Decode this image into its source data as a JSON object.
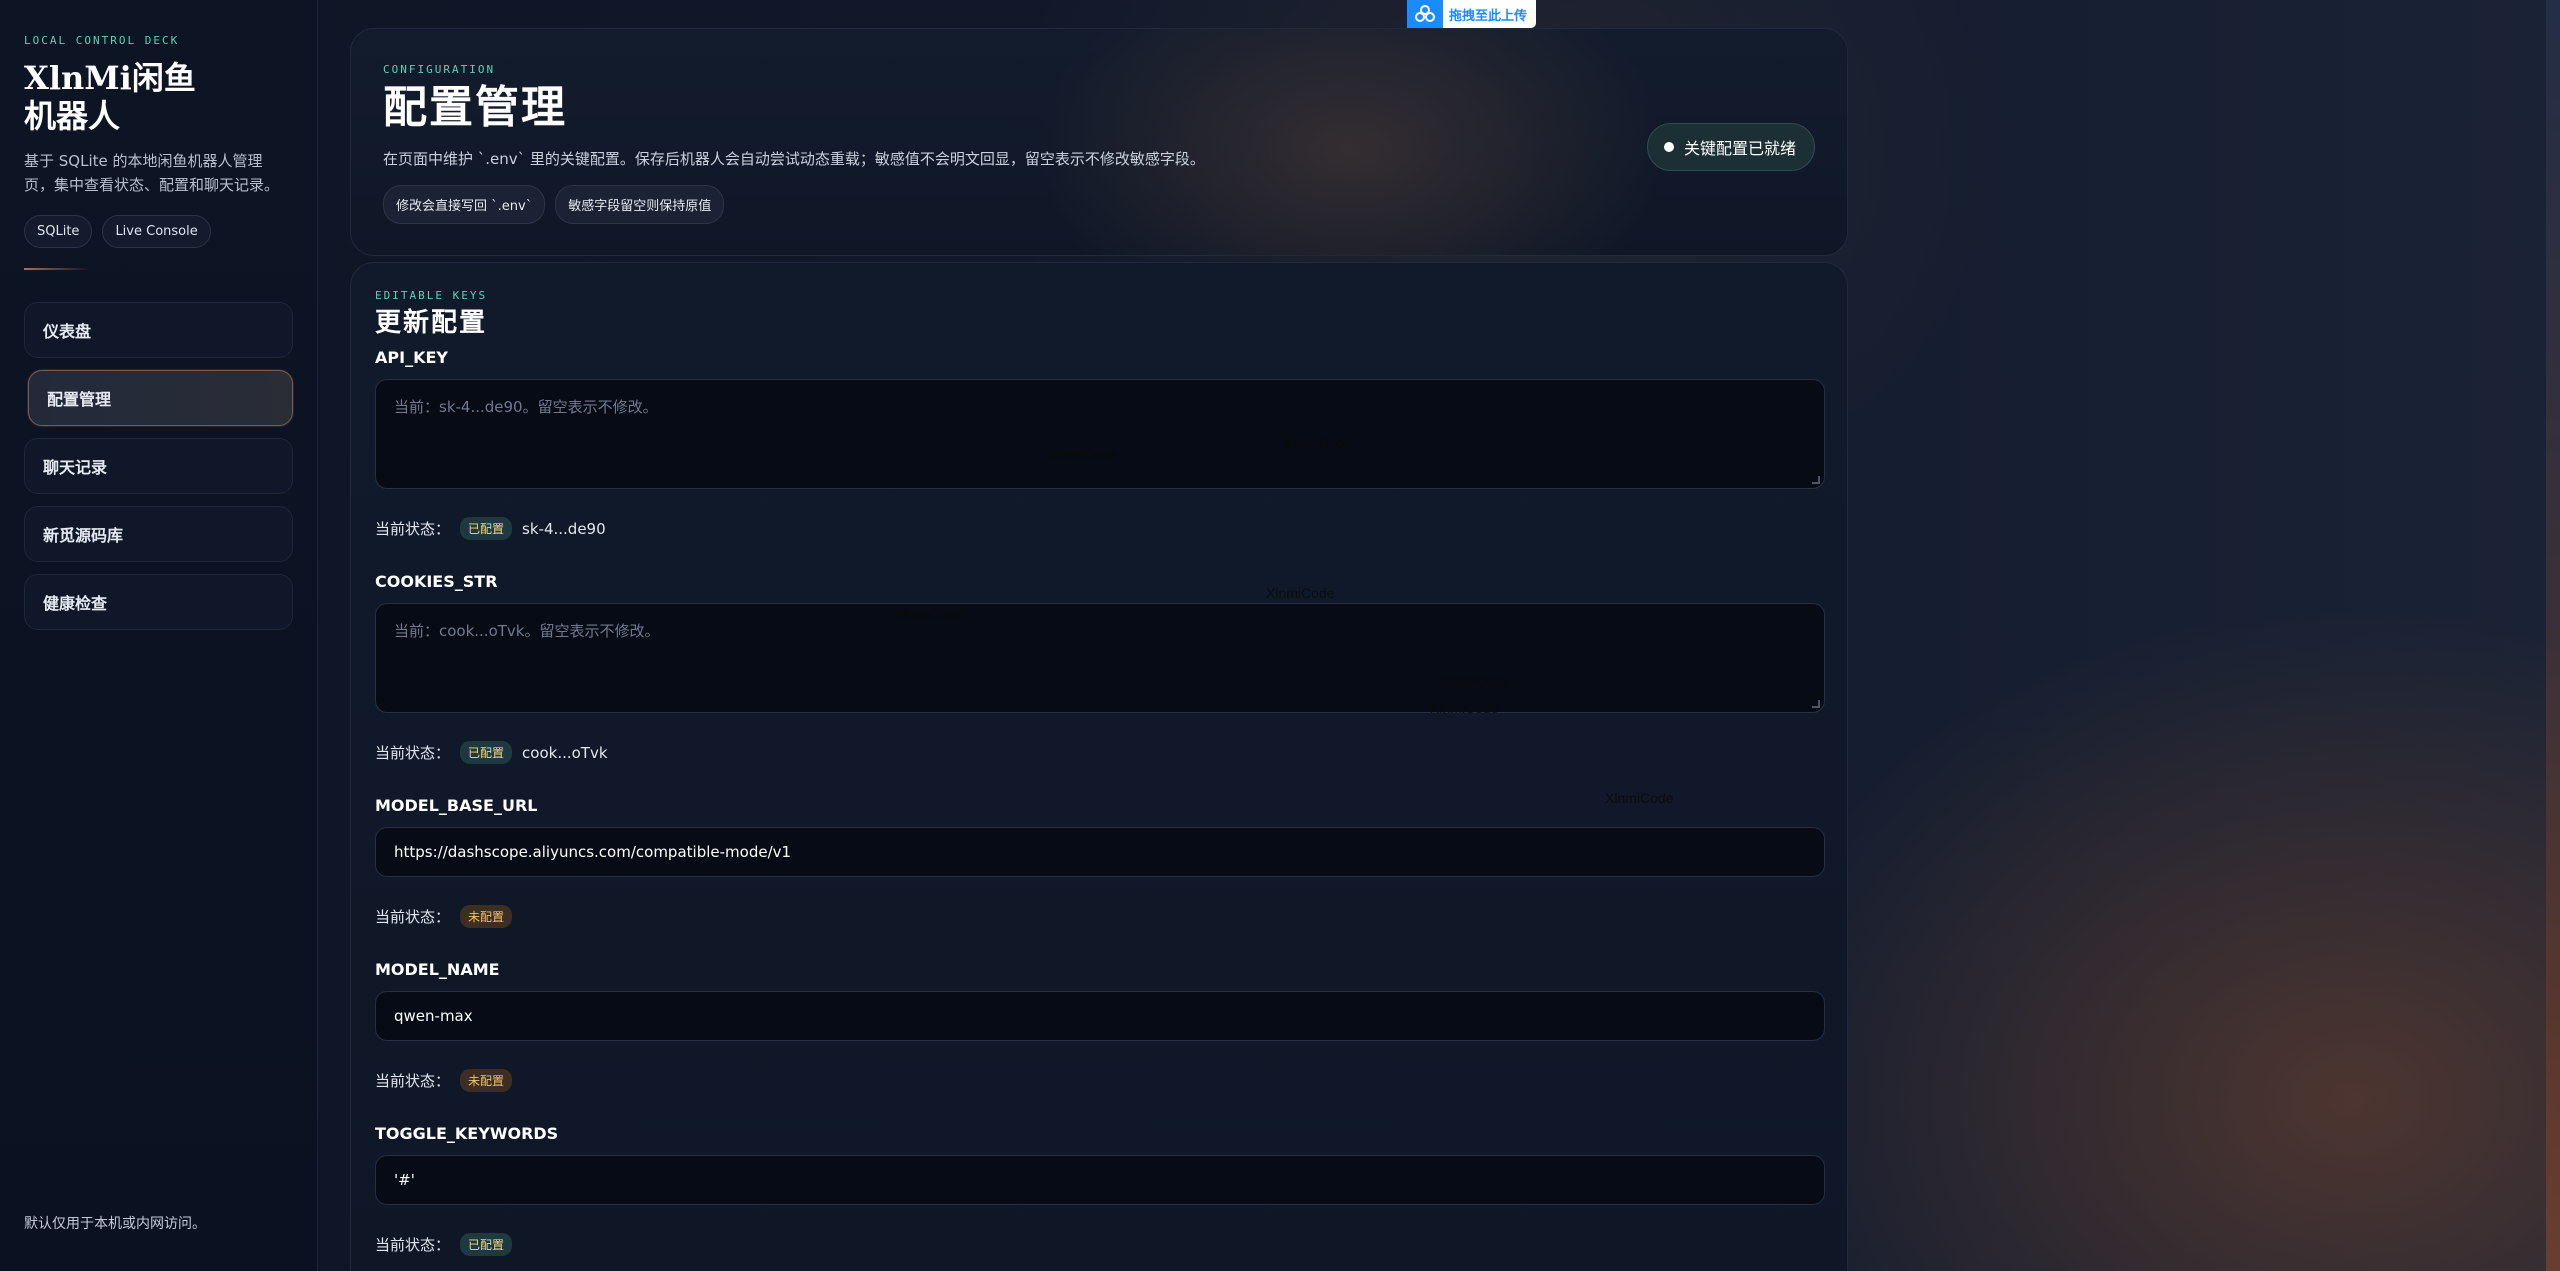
{
  "sidebar": {
    "eyebrow": "LOCAL CONTROL DECK",
    "brand": "XlnMi闲鱼机器人",
    "description": "基于 SQLite 的本地闲鱼机器人管理页，集中查看状态、配置和聊天记录。",
    "chips": [
      "SQLite",
      "Live Console"
    ],
    "nav": [
      {
        "label": "仪表盘",
        "active": false
      },
      {
        "label": "配置管理",
        "active": true
      },
      {
        "label": "聊天记录",
        "active": false
      },
      {
        "label": "新觅源码库",
        "active": false
      },
      {
        "label": "健康检查",
        "active": false
      }
    ],
    "footer": "默认仅用于本机或内网访问。"
  },
  "upload_widget": {
    "label": "拖拽至此上传",
    "icon": "cloud-upload-icon"
  },
  "hero": {
    "eyebrow": "CONFIGURATION",
    "title": "配置管理",
    "description": "在页面中维护 `.env` 里的关键配置。保存后机器人会自动尝试动态重载；敏感值不会明文回显，留空表示不修改敏感字段。",
    "tags": [
      "修改会直接写回 `.env`",
      "敏感字段留空则保持原值"
    ],
    "ready_status": "关键配置已就绪"
  },
  "form": {
    "eyebrow": "EDITABLE KEYS",
    "title": "更新配置",
    "status_prefix": "当前状态：",
    "fields": [
      {
        "key": "API_KEY",
        "type": "textarea",
        "value": "",
        "placeholder": "当前：sk-4...de90。留空表示不修改。",
        "status": "已配置",
        "status_value": "sk-4...de90"
      },
      {
        "key": "COOKIES_STR",
        "type": "textarea",
        "value": "",
        "placeholder": "当前：cook...oTvk。留空表示不修改。",
        "status": "已配置",
        "status_value": "cook...oTvk"
      },
      {
        "key": "MODEL_BASE_URL",
        "type": "input",
        "value": "https://dashscope.aliyuncs.com/compatible-mode/v1",
        "placeholder": "",
        "status": "未配置",
        "status_value": ""
      },
      {
        "key": "MODEL_NAME",
        "type": "input",
        "value": "qwen-max",
        "placeholder": "",
        "status": "未配置",
        "status_value": ""
      },
      {
        "key": "TOGGLE_KEYWORDS",
        "type": "input",
        "value": "'#'",
        "placeholder": "",
        "status": "已配置",
        "status_value": ""
      }
    ]
  },
  "watermark_text": "XlnmiCode",
  "colors": {
    "accent_teal": "#59d4b5",
    "accent_warm": "#b86a4d",
    "badge_ok_bg": "#1f3a3f",
    "badge_no_bg": "#3d2e22"
  }
}
